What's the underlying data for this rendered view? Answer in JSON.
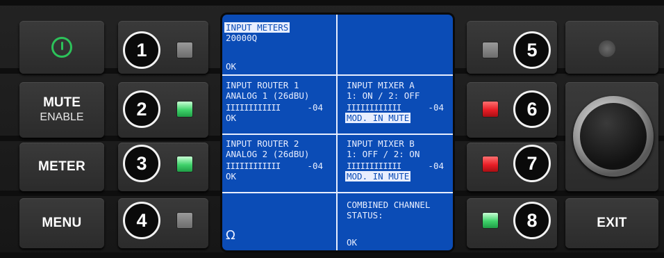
{
  "left_keys": {
    "power_icon": "power-icon",
    "mute_line1": "MUTE",
    "mute_line2": "ENABLE",
    "meter": "METER",
    "menu": "MENU"
  },
  "channel_numbers": [
    "1",
    "2",
    "3",
    "4",
    "5",
    "6",
    "7",
    "8"
  ],
  "leds": {
    "ch1": {
      "state": "off",
      "color": "#8a8a8a"
    },
    "ch2": {
      "state": "on",
      "color": "#3fd26a"
    },
    "ch3": {
      "state": "on",
      "color": "#3fd26a"
    },
    "ch4": {
      "state": "off",
      "color": "#8a8a8a"
    },
    "ch5": {
      "state": "off",
      "color": "#8a8a8a"
    },
    "ch6": {
      "state": "on",
      "color": "#e81e26"
    },
    "ch7": {
      "state": "on",
      "color": "#e81e26"
    },
    "ch8": {
      "state": "on",
      "color": "#3fd26a"
    }
  },
  "right_keys": {
    "exit": "EXIT",
    "indicator": "status-dot",
    "knob": "rotary-encoder"
  },
  "screen": {
    "background": "#0b4cb6",
    "input_meters": {
      "title": "INPUT METERS",
      "model": "20000Q",
      "status": "OK"
    },
    "router1": {
      "title": "INPUT ROUTER 1",
      "source": "ANALOG 1 (26dBU)",
      "bars": "IIIIIIIIIIII",
      "level": "-04",
      "status": "OK"
    },
    "router2": {
      "title": "INPUT ROUTER 2",
      "source": "ANALOG 2 (26dBU)",
      "bars": "IIIIIIIIIIII",
      "level": "-04",
      "status": "OK"
    },
    "mixer_a": {
      "title": "INPUT MIXER A",
      "routing": "1: ON / 2: OFF",
      "bars": "IIIIIIIIIIII",
      "level": "-04",
      "status": "MOD. IN MUTE"
    },
    "mixer_b": {
      "title": "INPUT MIXER B",
      "routing": "1: OFF / 2: ON",
      "bars": "IIIIIIIIIIII",
      "level": "-04",
      "status": "MOD. IN MUTE"
    },
    "combined": {
      "line1": "COMBINED CHANNEL",
      "line2": "STATUS:",
      "status": "OK"
    },
    "omega": "Ω"
  }
}
